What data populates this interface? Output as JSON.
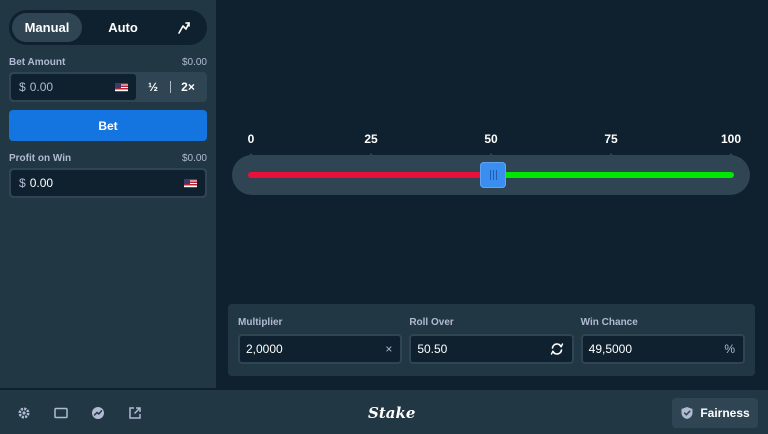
{
  "sidebar": {
    "tabs": {
      "manual": "Manual",
      "auto": "Auto"
    },
    "bet_amount": {
      "label": "Bet Amount",
      "display": "$0.00",
      "currency": "$",
      "value": "0.00"
    },
    "half_label": "½",
    "double_label": "2×",
    "bet_button": "Bet",
    "profit": {
      "label": "Profit on Win",
      "display": "$0.00",
      "currency": "$",
      "value": "0.00"
    }
  },
  "slider": {
    "ticks": [
      "0",
      "25",
      "50",
      "75",
      "100"
    ],
    "value": 50.5,
    "min": 0,
    "max": 100,
    "colors": {
      "under": "#e9113c",
      "over": "#00e701",
      "thumb": "#3a8ef0"
    }
  },
  "info": {
    "multiplier": {
      "label": "Multiplier",
      "value": "2,0000",
      "icon": "×"
    },
    "roll_over": {
      "label": "Roll Over",
      "value": "50.50"
    },
    "win_chance": {
      "label": "Win Chance",
      "value": "49,5000",
      "icon": "%"
    }
  },
  "footer": {
    "logo": "Stake",
    "fairness": "Fairness"
  }
}
